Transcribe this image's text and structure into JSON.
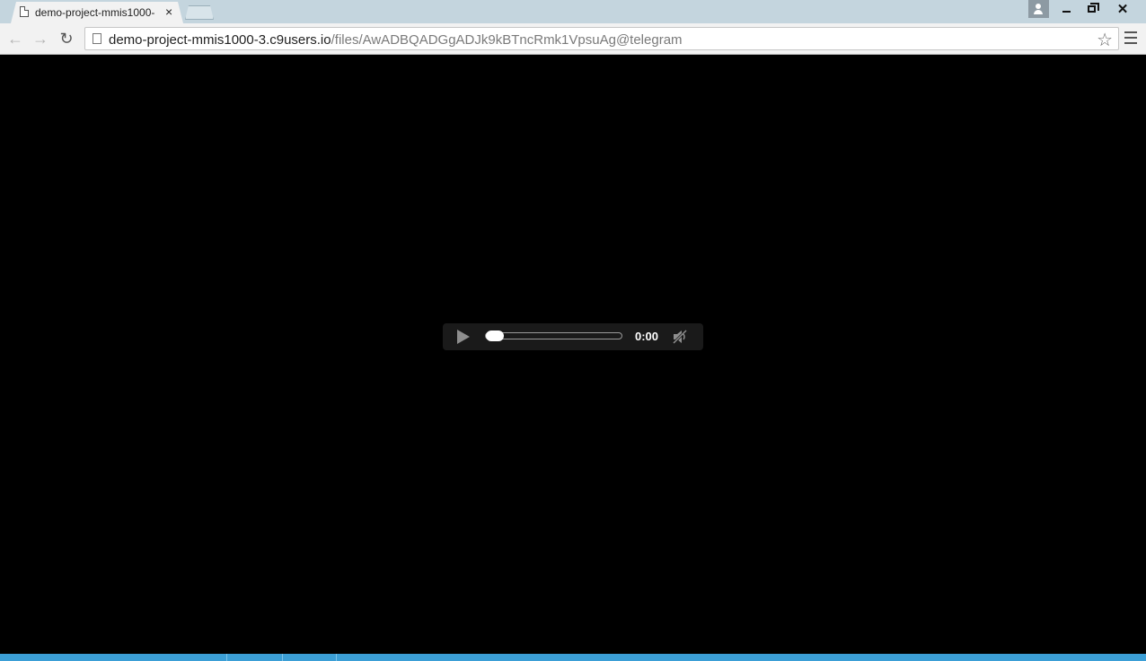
{
  "browser": {
    "tab_title": "demo-project-mmis1000-",
    "tab_close": "×",
    "window_close": "✕",
    "url_host": "demo-project-mmis1000-3.c9users.io",
    "url_path": "/files/AwADBQADGgADJk9kBTncRmk1VpsuAg@telegram",
    "back_glyph": "←",
    "forward_glyph": "→",
    "reload_glyph": "↻",
    "star_glyph": "☆"
  },
  "audio_player": {
    "time": "0:00",
    "progress_fraction": 0,
    "muted": true
  },
  "icons": {
    "tab": "page-icon",
    "omnibox": "page-icon",
    "bookmark": "star-icon",
    "menu": "hamburger-icon",
    "play": "play-icon",
    "volume": "muted-speaker-icon"
  }
}
